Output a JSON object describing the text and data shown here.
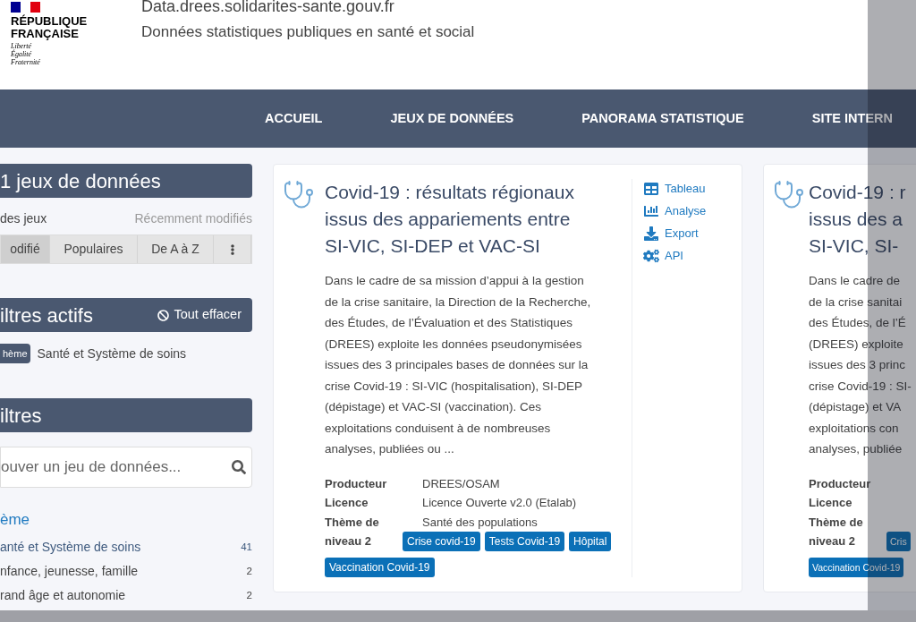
{
  "header": {
    "logo_lines": [
      "RÉPUBLIQUE",
      "FRANÇAISE"
    ],
    "motto": [
      "Liberté",
      "Égalité",
      "Fraternité"
    ],
    "site_title": "Data.drees.solidarites-sante.gouv.fr",
    "tagline": "Données statistiques publiques en santé et social"
  },
  "nav": [
    {
      "label": "ACCUEIL"
    },
    {
      "label": "JEUX DE DONNÉES"
    },
    {
      "label": "PANORAMA STATISTIQUE"
    },
    {
      "label": "SITE INTERN"
    }
  ],
  "sidebar": {
    "count_title": "1 jeux de données",
    "sort_label": "des jeux",
    "sort_hint": "Récemment modifiés",
    "sort_options": [
      {
        "kind": "text",
        "label": "odifié",
        "selected": true
      },
      {
        "kind": "text",
        "label": "Populaires",
        "selected": false
      },
      {
        "kind": "text",
        "label": "De A à Z",
        "selected": false
      },
      {
        "kind": "menu",
        "selected": false
      }
    ],
    "active_filters": {
      "title": "iltres actifs",
      "clear_label": "Tout effacer",
      "items": [
        {
          "tag": "hème",
          "value": "Santé et Système de soins"
        }
      ]
    },
    "filters": {
      "title": "iltres",
      "search_placeholder": "ouver un jeu de données...",
      "facet_title": "ème",
      "items": [
        {
          "label": "anté et Système de soins",
          "count": "41",
          "selected": true
        },
        {
          "label": "nfance, jeunesse, famille",
          "count": "2",
          "selected": false
        },
        {
          "label": "rand âge et autonomie",
          "count": "2",
          "selected": false
        }
      ]
    }
  },
  "datasets": [
    {
      "title_lines": [
        "Covid-19 : résultats régionaux",
        "issus des appariements entre",
        "SI-VIC, SI-DEP et VAC-SI"
      ],
      "description_lines": [
        "Dans le cadre de sa mission d’appui à la gestion",
        "de la crise sanitaire, la Direction de la Recherche,",
        "des Études, de l’Évaluation et des Statistiques",
        "(DREES) exploite les données pseudonymisées",
        "issues des 3 principales bases de données sur la",
        "crise Covid-19 : SI-VIC (hospitalisation), SI-DEP",
        "(dépistage) et VAC-SI (vaccination). Ces",
        "exploitations conduisent à de nombreuses",
        "analyses, publiées ou ..."
      ],
      "actions": [
        {
          "kind": "table",
          "label": "Tableau"
        },
        {
          "kind": "chart",
          "label": "Analyse"
        },
        {
          "kind": "export",
          "label": "Export"
        },
        {
          "kind": "api",
          "label": "API"
        }
      ],
      "meta": [
        {
          "label": "Producteur",
          "value": "DREES/OSAM"
        },
        {
          "label": "Licence",
          "value": "Licence Ouverte v2.0 (Etalab)"
        },
        {
          "label": "Thème de niveau 2",
          "value": "Santé des populations"
        }
      ],
      "tag_rows": [
        [
          {
            "label": "Crise covid-19"
          },
          {
            "label": "Tests Covid-19"
          },
          {
            "label": "Hôpital"
          }
        ],
        [
          {
            "label": "Vaccination Covid-19"
          }
        ]
      ]
    },
    {
      "title_lines": [
        "Covid-19 : r",
        "issus des a",
        "SI-VIC, SI-"
      ],
      "description_lines": [
        "Dans le cadre de",
        "de la crise sanitai",
        "des Études, de l’É",
        "(DREES) exploite",
        "issues des 3 princ",
        "crise Covid-19 : SI-",
        "(dépistage) et VA",
        "exploitations con",
        "analyses, publiée"
      ],
      "meta": [
        {
          "label": "Producteur"
        },
        {
          "label": "Licence"
        },
        {
          "label": "Thème de niveau 2"
        }
      ],
      "tag_rows": [
        [
          {
            "label": "Cris"
          }
        ],
        [
          {
            "label": "Vaccination Covid-19"
          }
        ]
      ]
    }
  ]
}
